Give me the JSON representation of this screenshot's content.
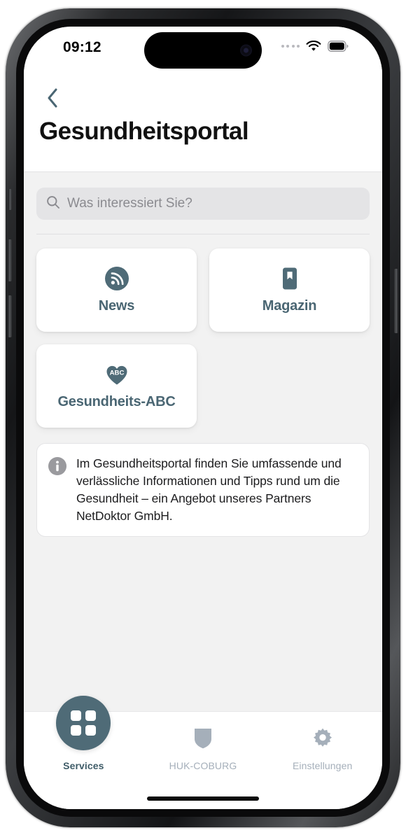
{
  "status_bar": {
    "time": "09:12",
    "signal_icon": "signal-dots-icon",
    "wifi_icon": "wifi-icon",
    "battery_icon": "battery-icon"
  },
  "header": {
    "back_icon": "chevron-left-icon",
    "title": "Gesundheitsportal"
  },
  "search": {
    "icon": "search-icon",
    "placeholder": "Was interessiert Sie?",
    "value": ""
  },
  "tiles": [
    {
      "label": "News",
      "icon": "rss-icon"
    },
    {
      "label": "Magazin",
      "icon": "book-bookmark-icon"
    },
    {
      "label": "Gesundheits-ABC",
      "icon": "heart-abc-icon",
      "icon_text": "ABC"
    }
  ],
  "info_box": {
    "icon": "info-icon",
    "text": "Im Gesundheitsportal finden Sie umfassende und verlässliche Informationen und Tipps rund um die Gesundheit – ein Angebot unseres Partners NetDoktor GmbH."
  },
  "tab_bar": {
    "tabs": [
      {
        "label": "Services",
        "icon": "grid-icon",
        "active": true
      },
      {
        "label": "HUK-COBURG",
        "icon": "shield-icon",
        "active": false
      },
      {
        "label": "Einstellungen",
        "icon": "gear-icon",
        "active": false
      }
    ]
  },
  "colors": {
    "accent_slate": "#4a6673",
    "tab_active": "#4f6b77",
    "tab_inactive": "#a5afba",
    "content_bg": "#f2f2f2",
    "card_bg": "#ffffff",
    "search_bg": "#e4e4e6",
    "info_icon_gray": "#9a9a9e"
  }
}
